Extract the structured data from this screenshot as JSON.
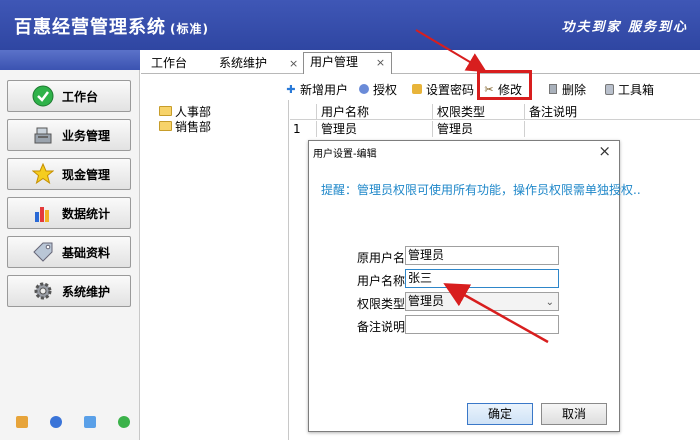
{
  "header": {
    "title": "百惠经营管理系统",
    "edition": "(标准)",
    "slogan": "功夫到家 服务到心"
  },
  "sidebar": {
    "items": [
      {
        "label": "工作台",
        "icon": "check-circle-icon"
      },
      {
        "label": "业务管理",
        "icon": "cash-register-icon"
      },
      {
        "label": "现金管理",
        "icon": "star-icon"
      },
      {
        "label": "数据统计",
        "icon": "bar-chart-icon"
      },
      {
        "label": "基础资料",
        "icon": "tag-icon"
      },
      {
        "label": "系统维护",
        "icon": "gear-icon"
      }
    ],
    "bottom_icons": [
      "edit-icon",
      "clock-icon",
      "window-icon",
      "refresh-icon"
    ]
  },
  "tabs": [
    {
      "label": "工作台"
    },
    {
      "label": "系统维护"
    },
    {
      "label": "用户管理"
    }
  ],
  "toolbar": {
    "add_user": "新增用户",
    "authorize": "授权",
    "set_password": "设置密码",
    "modify": "修改",
    "delete": "删除",
    "toolbox": "工具箱"
  },
  "tree": {
    "items": [
      "人事部",
      "销售部"
    ]
  },
  "grid": {
    "columns": [
      "用户名称",
      "权限类型",
      "备注说明"
    ],
    "rows": [
      {
        "index": "1",
        "name": "管理员",
        "role": "管理员",
        "note": ""
      }
    ]
  },
  "dialog": {
    "title": "用户设置-编辑",
    "hint": "提醒：管理员权限可使用所有功能，操作员权限需单独授权..",
    "fields": {
      "original_username_label": "原用户名",
      "original_username_value": "管理员",
      "username_label": "用户名称",
      "username_value": "张三",
      "role_label": "权限类型",
      "role_value": "管理员",
      "note_label": "备注说明",
      "note_value": ""
    },
    "ok": "确定",
    "cancel": "取消"
  },
  "colors": {
    "header_bg": "#3a51ae",
    "hint_text": "#1e87c9",
    "annotation_red": "#d81e1e"
  }
}
